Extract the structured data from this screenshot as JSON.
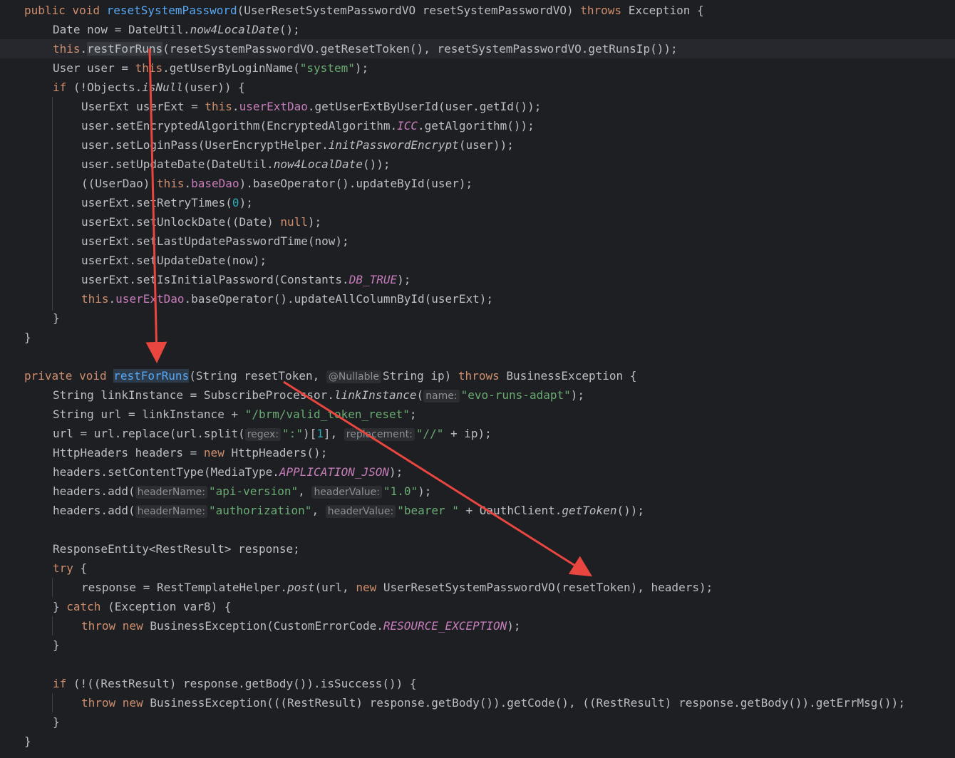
{
  "colors": {
    "background": "#1e1f22",
    "keyword": "#cf8e6d",
    "method": "#56a8f5",
    "string": "#6aab73",
    "number": "#2aacb8",
    "field": "#c77dbb",
    "arrow": "#e8463f"
  },
  "code": {
    "l1": {
      "kw1": "public void ",
      "fn": "resetSystemPassword",
      "t1": "(UserResetSystemPasswordVO resetSystemPasswordVO) ",
      "kw2": "throws",
      "t2": " Exception {"
    },
    "l2": {
      "t1": "Date now = DateUtil.",
      "it": "now4LocalDate",
      "t2": "();"
    },
    "l3": {
      "kw1": "this",
      "t1": ".",
      "call": "restForRuns",
      "t2": "(resetSystemPasswordVO.getResetToken(), resetSystemPasswordVO.getRunsIp());"
    },
    "l4": {
      "t1": "User user = ",
      "kw1": "this",
      "t2": ".getUserByLoginName(",
      "str": "\"system\"",
      "t3": ");"
    },
    "l5": {
      "kw1": "if",
      "t1": " (!Objects.",
      "it": "isNull",
      "t2": "(user)) {"
    },
    "l6": {
      "t1": "UserExt userExt = ",
      "kw1": "this",
      "t2": ".",
      "fld": "userExtDao",
      "t3": ".getUserExtByUserId(user.getId());"
    },
    "l7": {
      "t1": "user.setEncryptedAlgorithm(EncryptedAlgorithm.",
      "sfld": "ICC",
      "t2": ".getAlgorithm());"
    },
    "l8": {
      "t1": "user.setLoginPass(UserEncryptHelper.",
      "it": "initPasswordEncrypt",
      "t2": "(user));"
    },
    "l9": {
      "t1": "user.setUpdateDate(DateUtil.",
      "it": "now4LocalDate",
      "t2": "());"
    },
    "l10": {
      "t1": "((UserDao) ",
      "kw1": "this",
      "t2": ".",
      "fld": "baseDao",
      "t3": ").baseOperator().updateById(user);"
    },
    "l11": {
      "t1": "userExt.setRetryTimes(",
      "num": "0",
      "t2": ");"
    },
    "l12": {
      "t1": "userExt.setUnlockDate((Date) ",
      "kw1": "null",
      "t2": ");"
    },
    "l13": {
      "t1": "userExt.setLastUpdatePasswordTime(now);"
    },
    "l14": {
      "t1": "userExt.setUpdateDate(now);"
    },
    "l15": {
      "t1": "userExt.setIsInitialPassword(Constants.",
      "sfld": "DB_TRUE",
      "t2": ");"
    },
    "l16": {
      "kw1": "this",
      "t1": ".",
      "fld": "userExtDao",
      "t2": ".baseOperator().updateAllColumnById(userExt);"
    },
    "l17": {
      "t1": "}"
    },
    "l18": {
      "t1": "}"
    },
    "l20": {
      "kw1": "private void ",
      "fn": "restForRuns",
      "t1": "(String resetToken, ",
      "hint": "@Nullable",
      "t2": "String ip) ",
      "kw2": "throws",
      "t3": " BusinessException {"
    },
    "l21": {
      "t1": "String linkInstance = SubscribeProcessor.",
      "it": "linkInstance",
      "t2": "(",
      "hint": "name:",
      "str": "\"evo-runs-adapt\"",
      "t3": ");"
    },
    "l22": {
      "t1": "String url = linkInstance + ",
      "str": "\"/brm/valid_token_reset\"",
      "t2": ";"
    },
    "l23": {
      "t1": "url = url.replace(url.split(",
      "hint1": "regex:",
      "str1": "\":\"",
      "t2": ")[",
      "num": "1",
      "t3": "], ",
      "hint2": "replacement:",
      "str2": "\"//\"",
      "t4": " + ip);"
    },
    "l24": {
      "t1": "HttpHeaders headers = ",
      "kw1": "new",
      "t2": " HttpHeaders();"
    },
    "l25": {
      "t1": "headers.setContentType(MediaType.",
      "sfld": "APPLICATION_JSON",
      "t2": ");"
    },
    "l26": {
      "t1": "headers.add(",
      "hint1": "headerName:",
      "str1": "\"api-version\"",
      "t2": ", ",
      "hint2": "headerValue:",
      "str2": "\"1.0\"",
      "t3": ");"
    },
    "l27": {
      "t1": "headers.add(",
      "hint1": "headerName:",
      "str1": "\"authorization\"",
      "t2": ", ",
      "hint2": "headerValue:",
      "str2": "\"bearer \"",
      "t3": " + OauthClient.",
      "it": "getToken",
      "t4": "());"
    },
    "l29": {
      "t1": "ResponseEntity<RestResult> response;"
    },
    "l30": {
      "kw1": "try",
      "t1": " {"
    },
    "l31": {
      "t1": "response = RestTemplateHelper.",
      "it": "post",
      "t2": "(url, ",
      "kw1": "new",
      "t3": " UserResetSystemPasswordVO(resetToken), headers);"
    },
    "l32": {
      "t1": "} ",
      "kw1": "catch",
      "t2": " (Exception var8) {"
    },
    "l33": {
      "kw1": "throw new",
      "t1": " BusinessException(CustomErrorCode.",
      "sfld": "RESOURCE_EXCEPTION",
      "t2": ");"
    },
    "l34": {
      "t1": "}"
    },
    "l36": {
      "kw1": "if",
      "t1": " (!((RestResult) response.getBody()).isSuccess()) {"
    },
    "l37": {
      "kw1": "throw new",
      "t1": " BusinessException(((RestResult) response.getBody()).getCode(), ((RestResult) response.getBody()).getErrMsg());"
    },
    "l38": {
      "t1": "}"
    },
    "l39": {
      "t1": "}"
    }
  }
}
